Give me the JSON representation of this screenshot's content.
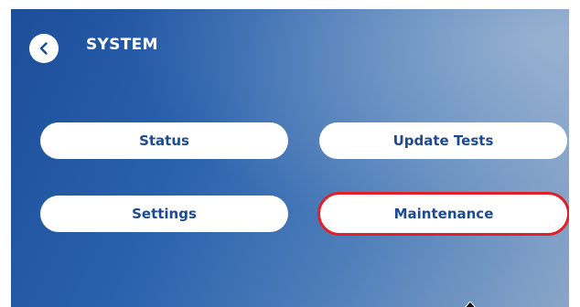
{
  "header": {
    "title": "SYSTEM",
    "back_icon": "chevron-left-icon"
  },
  "menu": {
    "status_label": "Status",
    "update_tests_label": "Update Tests",
    "settings_label": "Settings",
    "maintenance_label": "Maintenance"
  },
  "colors": {
    "background_start": "#1d4e9a",
    "background_end": "#8aa6c8",
    "button_text": "#1c4a93",
    "highlight": "#e0202a"
  }
}
